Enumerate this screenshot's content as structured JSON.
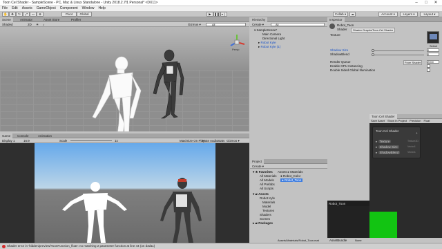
{
  "window": {
    "title": "Toon Cel Shader - SampleScene - PC, Mac & Linux Standalone - Unity 2018.2.7f1 Personal* <DX11>",
    "min": "–",
    "max": "□",
    "close": "✕"
  },
  "menu": [
    "File",
    "Edit",
    "Assets",
    "GameObject",
    "Component",
    "Window",
    "Help"
  ],
  "toolbar": {
    "pivot": "Pivot",
    "global": "Global",
    "collab": "Collab ▾",
    "account": "Account ▾",
    "layers": "Layers ▾",
    "layout": "Layout ▾"
  },
  "scene": {
    "tabs": [
      "Scene",
      "Animator",
      "Asset Store",
      "Profiler"
    ],
    "shading": "Shaded",
    "mode2d": "2D",
    "gizmos": "Gizmos ▾",
    "search": "All",
    "persp": "Persp"
  },
  "hierarchy": {
    "tab": "Hierarchy",
    "create": "Create ▾",
    "search": "All",
    "scene": "SampleScene*",
    "items": [
      "Main Camera",
      "Directional Light",
      "Robot Kyle",
      "Robot Kyle (1)"
    ]
  },
  "game": {
    "tabs": [
      "Game",
      "Console",
      "Animation"
    ],
    "display": "Display 1",
    "aspect": "16:9",
    "scale_label": "Scale",
    "scale_value": "1x",
    "buttons": [
      "Maximize On Play",
      "Mute Audio",
      "Stats",
      "Gizmos ▾"
    ]
  },
  "project": {
    "tab": "Project",
    "create": "Create ▾",
    "favorites": "Favorites",
    "fav_items": [
      "All Materials",
      "All Models",
      "All Prefabs",
      "All Scripts"
    ],
    "assets": "Assets",
    "asset_items": [
      "Robot Kyle",
      "Materials",
      "Model",
      "Textures",
      "Shaders",
      "Scenes"
    ],
    "packages": "Packages",
    "breadcrumb": [
      "Assets",
      "Materials"
    ],
    "files": [
      "Robot_Color",
      "Robot_Toon"
    ],
    "bottom_path": "Assets/Materials/Robot_Toon.mat"
  },
  "inspector": {
    "tab": "Inspector",
    "material": "Robot_Toon",
    "shader_label": "Shader",
    "shader_value": "Shader Graphs/Toon Cel Shader",
    "texture_label": "Texture",
    "select": "Select",
    "props": [
      {
        "label": "Shadow Size",
        "value": "0"
      },
      {
        "label": "ShadowBlend",
        "value": "0"
      }
    ],
    "render_queue_label": "Render Queue",
    "render_queue_mode": "From Shader",
    "render_queue_value": "2000",
    "gpu_label": "Enable GPU Instancing",
    "gi_label": "Double Sided Global Illumination",
    "preview_label": "Robot_Toon",
    "assetbundle": "AssetBundle",
    "assetbundle_value": "None"
  },
  "shadergraph": {
    "tab": "Toon Cel Shader",
    "menu": [
      "Save Asset",
      "Show In Project",
      "Precision",
      "Float"
    ],
    "node_title": "Toon Cel Shader",
    "add": "+",
    "props": [
      {
        "name": "Texture",
        "type": "Texture2D"
      },
      {
        "name": "Shadow Size",
        "type": "Vector1"
      },
      {
        "name": "ShadowBlend",
        "type": "Vector1"
      }
    ]
  },
  "status": {
    "text": "Shader error in 'hidden/preview/ToonFunction_float': no matching 2 parameter function at line 44 (on d3d11)"
  }
}
